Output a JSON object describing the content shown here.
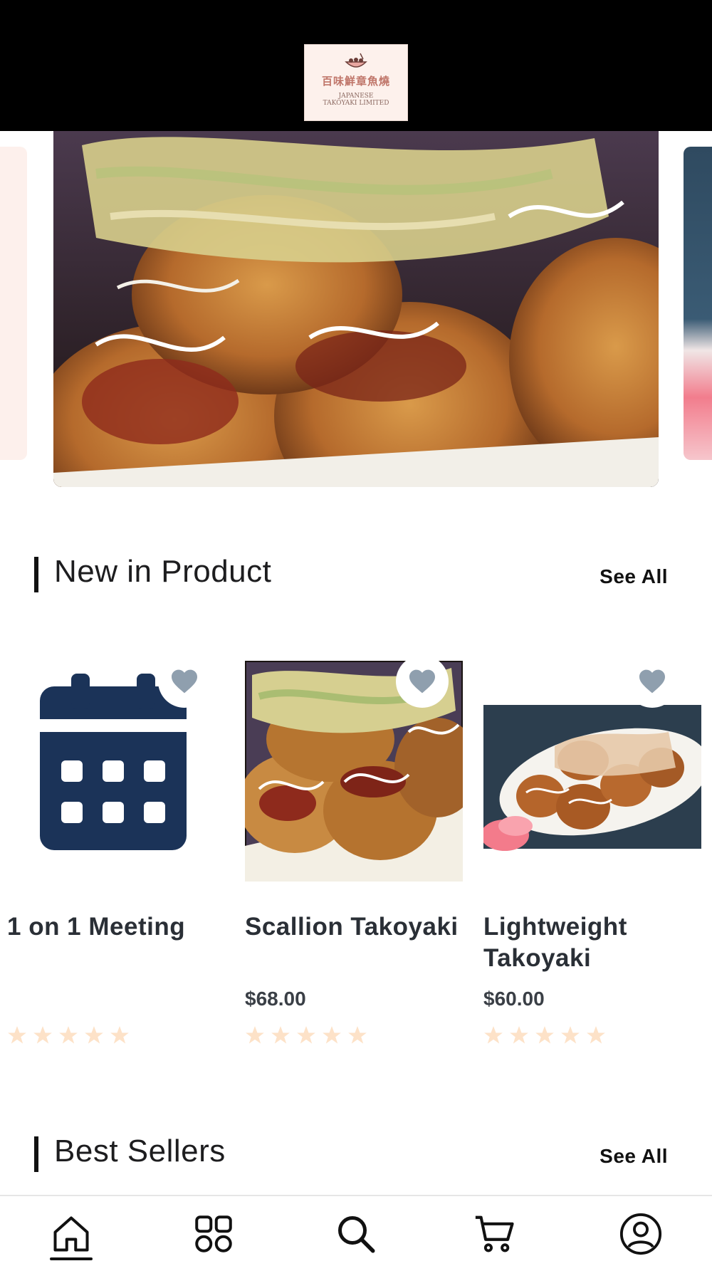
{
  "header": {
    "logo": {
      "chinese_name": "百味鮮章魚燒",
      "english_line1": "JAPANESE",
      "english_line2": "TAKOYAKI LIMITED",
      "icon": "takoyaki-bowl-icon"
    }
  },
  "carousel": {
    "banner_alt": "takoyaki-banner-image"
  },
  "new_in_product": {
    "title": "New in Product",
    "see_all": "See All",
    "items": [
      {
        "name": "1 on 1 Meeting",
        "price": "",
        "rating": 0,
        "image": "calendar-icon",
        "favorite": false
      },
      {
        "name": "Scallion Takoyaki",
        "price": "$68.00",
        "rating": 0,
        "image": "takoyaki-photo",
        "favorite": false
      },
      {
        "name": "Lightweight Takoyaki",
        "price": "$60.00",
        "rating": 0,
        "image": "takoyaki-plate-photo",
        "favorite": false
      }
    ]
  },
  "best_sellers": {
    "title": "Best Sellers",
    "see_all": "See All"
  },
  "bottom_nav": {
    "items": [
      {
        "icon": "home-icon",
        "active": true
      },
      {
        "icon": "grid-icon",
        "active": false
      },
      {
        "icon": "search-icon",
        "active": false
      },
      {
        "icon": "cart-icon",
        "active": false
      },
      {
        "icon": "user-icon",
        "active": false
      }
    ]
  },
  "colors": {
    "header_bg": "#000000",
    "navy": "#1b3358",
    "heart": "#8f9fae",
    "star_empty": "#fde2c8"
  }
}
